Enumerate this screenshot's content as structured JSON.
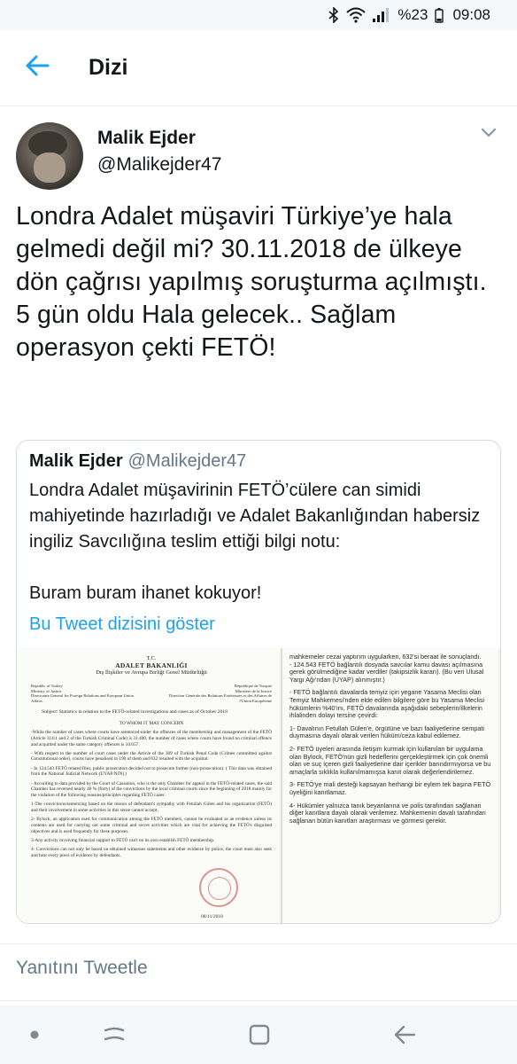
{
  "status_bar": {
    "battery": "%23",
    "time": "09:08",
    "icons": [
      "bluetooth-icon",
      "wifi-icon",
      "signal-icon"
    ]
  },
  "header": {
    "title": "Dizi",
    "back_icon": "arrow-left-icon"
  },
  "tweet": {
    "author_name": "Malik Ejder",
    "author_handle": "@Malikejder47",
    "text": "Londra Adalet müşaviri Türkiye’ye hala gelmedi değil mi? 30.11.2018 de ülkeye dön çağrısı yapılmış soruşturma açılmıştı. 5 gün oldu Hala gelecek.. Sağlam operasyon çekti FETÖ!"
  },
  "quoted_tweet": {
    "author_name": "Malik Ejder",
    "author_handle": "@Malikejder47",
    "text_p1": "Londra Adalet müşavirinin FETÖ’cülere can simidi mahiyetinde hazırladığı ve Adalet Bakanlığından habersiz ingiliz Savcılığına teslim ettiği bilgi notu:",
    "text_p2": "Buram buram ihanet kokuyor!",
    "show_thread": "Bu Tweet dizisini göster"
  },
  "document": {
    "left": {
      "header_tc": "T.C.",
      "header_ministry": "ADALET BAKANLIĞI",
      "header_dept": "Dış İlişkiler ve Avrupa Birliği Genel Müdürlüğü",
      "meta_left": "Republic of Turkey\nMinistry of Justice\nDirectorate General for Foreign Relations and European Union Affairs",
      "meta_right": "République de Turquie\nMinistère de la Justice\nDirection Générale des Relations Extérieures et des Affaires de l'Union Européenne",
      "subject": "Subject:  Statistics in relation to the FETÖ-related investigations and cases as of October 2018",
      "to_whom": "TO WHOM IT MAY CONCERN",
      "p1": "-While the number of cases where courts have sentenced under the offences of the membership and management of the FETÖ (Article 314/1 and 2 of the Turkish Criminal Code) is 31.400, the number of cases where courts have found no criminal offence and acquitted under the same category offences is 10.657.",
      "p2": "- With respect to the number of court cases under the Article of the 309 of Turkish Penal Code (Crimes committed against Constitutional order), courts have penalised in 190 of them and 632 resulted with the acquittal.",
      "p3": "- In 124.543 FETÖ related files, public prosecutors decided not to prosecute further (non-prosecution). ( This data was obtained from the National Judicial Network (UYAP/NJN).)",
      "p4": "- According to data provided by the Court of Cassation, who is the only Chamber for appeal in the FETÖ-related cases, the said Chamber has reversed nearly 40 % (forty) of the convictions by the local criminal courts since the beginning of 2018 mainly for the violation of the following reasons/principles regarding FETÖ cases:",
      "p5": "1-The convictions/sentencing based on the reason of defendant's sympathy with Fetullah Gülen and his organization (FETÖ) and their involvement in some activities in this sense cannot accept,",
      "p6": "2- Bylock, an application used for communication among the FETÖ members, cannot be evaluated as an evidence unless its contents are used for carrying out some criminal and secret activities which are vital for achieving the FETÖ's disguised objectives and is used frequently for these purposes.",
      "p7": "3-Any activity involving financial support to FETÖ can't on its own establish FETÖ membership.",
      "p8": "4- Convictions can not only be based on obtained witnesses statements and other evidence by police, the court must also seek and hear every piece of evidence by defendants.",
      "date": "08/11/2018"
    },
    "right": {
      "r0": "mahkemeler cezai yaptırım uygularken, 632'si beraat ile sonuçlandı.",
      "r1": "- 124.543 FETÖ bağlantılı dosyada savcılar kamu davası açılmasına gerek görülmediğine kadar verdiler (takipsizlik kararı). (Bu veri Ulusal Yargı Ağı'ndan (UYAP) alınmıştır.)",
      "r2": "- FETÖ bağlantılı davalarda temyiz için yegane Yasama Meclisi olan Temyiz Mahkemesi'nden elde edilen bilgilere göre bu Yasama Meclisi hükümlerin %40'ını, FETÖ davalarında aşağıdaki sebeplerin/ilkelerin ihlalinden dolayı tersine çevirdi:",
      "r3": "1- Davalının Fetullah Gülen'e, örgütüne ve bazı faaliyetlerine sempati duymasına dayalı olarak verilen hüküm/ceza kabul edilemez.",
      "r4": "2- FETÖ üyeleri arasında iletişim kurmak için kullanılan bir uygulama olan Bylock, FETÖ'nün gizli hedeflerini gerçekleştirmek için çok önemli olan ve suç içeren gizli faaliyetlerine dair içerikler barındırmıyorsa ve bu amaçlarla sıklıkla kullanılmamışsa kanıt olarak değerlendirilemez.",
      "r5": "3- FETÖ'ye mali desteği kapsayan herhangi bir eylem tek başına FETÖ üyeliğini kanıtlamaz.",
      "r6": "4- Hükümler yalnızca tanık beyanlarına ve polis tarafından sağlanan diğer kanıtlara dayalı olarak verilemez. Mahkemenin davalı tarafından sağlanan bütün kanıtları araştırması ve görmesi gerekir."
    }
  },
  "reply": {
    "label": "Yanıtını Tweetle"
  },
  "nav_bar": {
    "icons": [
      "dot-icon",
      "recents-icon",
      "home-square-icon",
      "back-arrow-icon"
    ]
  },
  "colors": {
    "accent": "#1da1f2",
    "muted": "#657786",
    "text": "#14171a"
  }
}
